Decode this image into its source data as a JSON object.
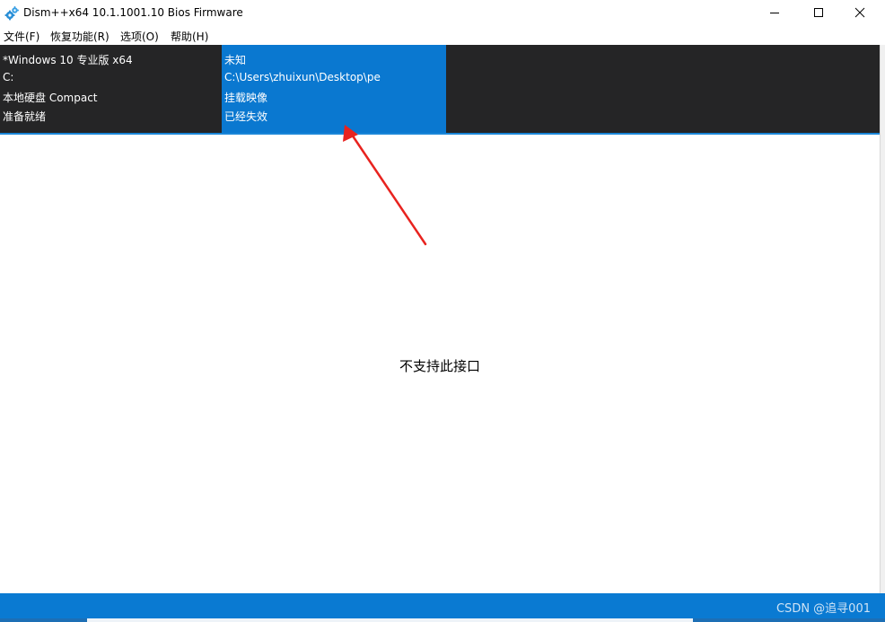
{
  "window": {
    "title": "Dism++x64 10.1.1001.10 Bios Firmware",
    "app_icon": "gears-icon"
  },
  "controls": {
    "minimize_icon": "minimize-icon",
    "maximize_icon": "maximize-icon",
    "close_icon": "close-icon"
  },
  "menu": {
    "items": [
      {
        "label": "文件(F)"
      },
      {
        "label": "恢复功能(R)"
      },
      {
        "label": "选项(O)"
      },
      {
        "label": "帮助(H)"
      }
    ]
  },
  "sessions": [
    {
      "selected": false,
      "lines": [
        "*Windows 10 专业版 x64",
        "C:",
        "本地硬盘 Compact",
        "准备就绪"
      ]
    },
    {
      "selected": true,
      "lines": [
        "未知",
        "C:\\Users\\zhuixun\\Desktop\\pe",
        "挂载映像",
        "已经失效"
      ]
    }
  ],
  "content": {
    "message": "不支持此接口"
  },
  "statusbar": {
    "watermark": "CSDN @追寻001"
  },
  "colors": {
    "session_bar_bg": "#252526",
    "selected_session_bg": "#0a78d0",
    "statusbar_bg": "#0a7ad2",
    "annotation_arrow": "#e8231f"
  }
}
